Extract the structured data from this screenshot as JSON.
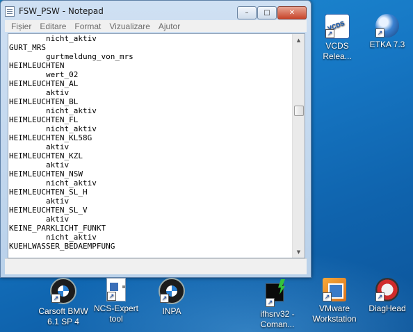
{
  "window": {
    "title": "FSW_PSW - Notepad",
    "buttons": {
      "minimize": "–",
      "maximize": "□",
      "close": "✕"
    }
  },
  "menu": [
    "Fișier",
    "Editare",
    "Format",
    "Vizualizare",
    "Ajutor"
  ],
  "editor_lines": [
    "        nicht_aktiv",
    "GURT_MRS",
    "        gurtmeldung_von_mrs",
    "HEIMLEUCHTEN",
    "        wert_02",
    "HEIMLEUCHTEN_AL",
    "        aktiv",
    "HEIMLEUCHTEN_BL",
    "        nicht_aktiv",
    "HEIMLEUCHTEN_FL",
    "        nicht_aktiv",
    "HEIMLEUCHTEN_KL58G",
    "        aktiv",
    "HEIMLEUCHTEN_KZL",
    "        aktiv",
    "HEIMLEUCHTEN_NSW",
    "        nicht_aktiv",
    "HEIMLEUCHTEN_SL_H",
    "        aktiv",
    "HEIMLEUCHTEN_SL_V",
    "        aktiv",
    "KEINE_PARKLICHT_FUNKT",
    "        nicht_aktiv",
    "KUEHLWASSER_BEDAEMPFUNG"
  ],
  "desktop_icons": {
    "vcds": "VCDS\nReleа...",
    "etka": "ETKA 7.3",
    "carsoft": "Carsoft BMW\n6.1 SP 4",
    "ncs_expert": "NCS-Expert\ntool",
    "inpa": "INPA",
    "ifhsrv32": "ifhsrv32 -\nComan...",
    "vmware": "VMware\nWorkstation",
    "diaghead": "DiagHead"
  }
}
